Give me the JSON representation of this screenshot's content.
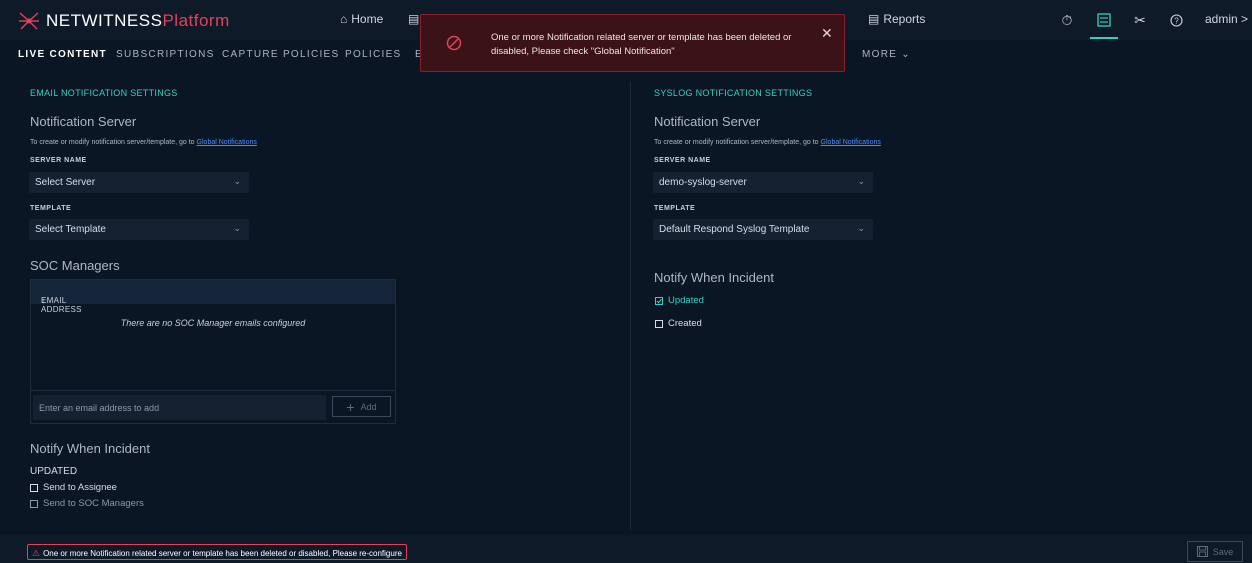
{
  "app": {
    "brand": "NETWITNESS",
    "brand_suffix": "Platform"
  },
  "topnav": {
    "home": "Home",
    "reports": "Reports",
    "user": "admin"
  },
  "subnav": {
    "items": [
      "LIVE CONTENT",
      "SUBSCRIPTIONS",
      "CAPTURE POLICIES",
      "POLICIES",
      "E"
    ],
    "more": "MORE"
  },
  "toast": {
    "message": "One or more Notification related server or template has been deleted or disabled, Please check \"Global Notification\""
  },
  "email": {
    "section_title": "EMAIL NOTIFICATION SETTINGS",
    "server_heading": "Notification Server",
    "help_prefix": "To create or modify notification server/template, go to",
    "help_link": "Global Notifications",
    "server_label": "SERVER NAME",
    "server_value": "Select Server",
    "template_label": "TEMPLATE",
    "template_value": "Select Template",
    "soc_heading": "SOC Managers",
    "table_header": "EMAIL ADDRESS",
    "empty_text": "There are no SOC Manager emails configured",
    "email_placeholder": "Enter an email address to add",
    "add_label": "Add",
    "notify_heading": "Notify When Incident",
    "updated_label": "UPDATED",
    "send_to_assignee": "Send to Assignee",
    "send_to_soc": "Send to SOC Managers"
  },
  "syslog": {
    "section_title": "SYSLOG NOTIFICATION SETTINGS",
    "server_heading": "Notification Server",
    "help_prefix": "To create or modify notification server/template, go to",
    "help_link": "Global Notifications",
    "server_label": "SERVER NAME",
    "server_value": "demo-syslog-server",
    "template_label": "TEMPLATE",
    "template_value": "Default Respond Syslog Template",
    "notify_heading": "Notify When Incident",
    "updated": "Updated",
    "created": "Created"
  },
  "footer": {
    "error": "One or more Notification related server or template has been deleted or disabled, Please re-configure",
    "save": "Save"
  },
  "colors": {
    "accent": "#2fd3c4",
    "error": "#e2435a",
    "link": "#4a8bff",
    "background": "#0a1624"
  }
}
